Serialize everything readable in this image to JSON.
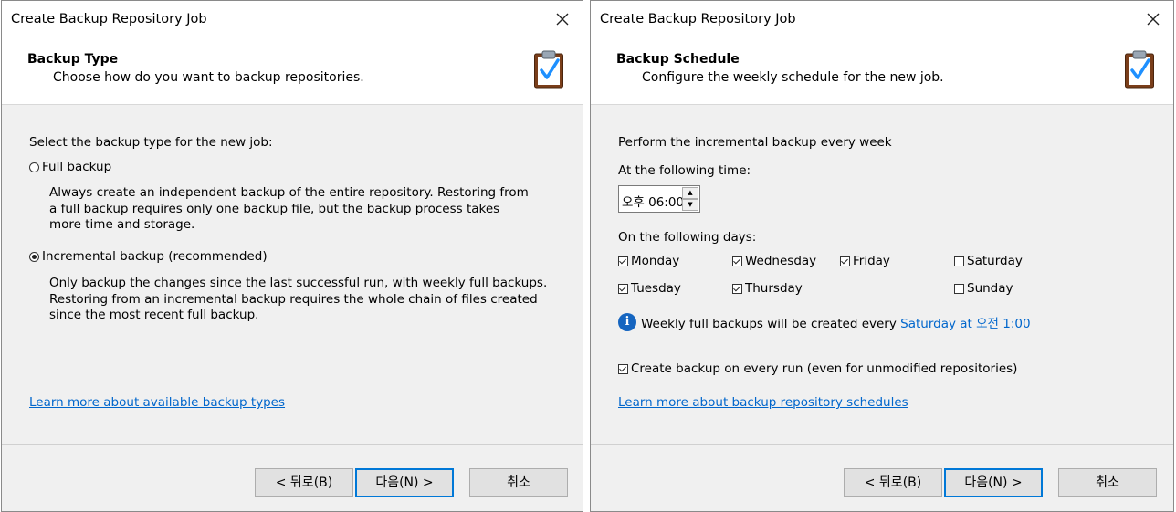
{
  "dialog1": {
    "title": "Create Backup Repository Job",
    "header_title": "Backup Type",
    "header_subtitle": "Choose how do you want to backup repositories.",
    "prompt": "Select the backup type for the new job:",
    "options": [
      {
        "label": "Full backup",
        "selected": false,
        "description": "Always create an independent backup of the entire repository. Restoring from a full backup requires only one backup file, but the backup process takes more time and storage."
      },
      {
        "label": "Incremental backup (recommended)",
        "selected": true,
        "description": "Only backup the changes since the last successful run, with weekly full backups. Restoring from an incremental backup requires the whole chain of files created since the most recent full backup."
      }
    ],
    "learn_more": "Learn more about available backup types",
    "buttons": {
      "back": "< 뒤로(B)",
      "next": "다음(N) >",
      "cancel": "취소"
    }
  },
  "dialog2": {
    "title": "Create Backup Repository Job",
    "header_title": "Backup Schedule",
    "header_subtitle": "Configure the weekly schedule for the new job.",
    "intro": "Perform the incremental backup every week",
    "time_label": "At the following time:",
    "time_value": "오후 06:00",
    "days_label": "On the following days:",
    "days": [
      {
        "label": "Monday",
        "checked": true
      },
      {
        "label": "Wednesday",
        "checked": true
      },
      {
        "label": "Friday",
        "checked": true
      },
      {
        "label": "Saturday",
        "checked": false
      },
      {
        "label": "Tuesday",
        "checked": true
      },
      {
        "label": "Thursday",
        "checked": true
      },
      {
        "label": "Sunday",
        "checked": false
      }
    ],
    "info_text": "Weekly full backups will be created every",
    "info_link": "Saturday at 오전 1:00",
    "every_run_label": "Create backup on every run (even for unmodified repositories)",
    "every_run_checked": true,
    "learn_more": "Learn more about backup repository schedules",
    "buttons": {
      "back": "< 뒤로(B)",
      "next": "다음(N) >",
      "cancel": "취소"
    }
  },
  "colors": {
    "accent": "#0078d7",
    "link": "#0066cc",
    "info": "#1565c0"
  },
  "icons": {
    "close": "close-icon",
    "clipboard": "clipboard-check-icon",
    "info": "info-icon"
  }
}
